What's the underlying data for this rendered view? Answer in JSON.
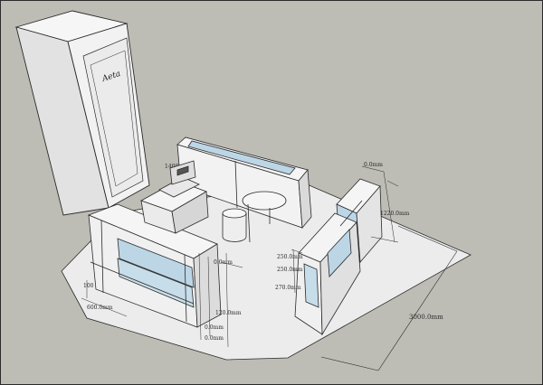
{
  "colors": {
    "background": "#bdbcb5",
    "floor": "#ececec",
    "cabinet_face": "#f4f4f4",
    "cabinet_shade": "#d8d8d8",
    "glass": "#bcd6e6",
    "edge": "#2a2a2a"
  },
  "dimensions": {
    "top_desk": "1400",
    "right_top": "0.0mm",
    "right_depth": "1220.0mm",
    "right_h1": "250.0mm",
    "right_h2": "250.0mm",
    "right_h3": "270.0mm",
    "left_depth": "0.0mm",
    "left_height": "100",
    "left_width": "600.0mm",
    "front_height": "120.0mm",
    "front_a": "0.0mm",
    "front_b": "0.0mm",
    "overall": "3000.0mm"
  },
  "logo": {
    "text": "Aeta"
  }
}
